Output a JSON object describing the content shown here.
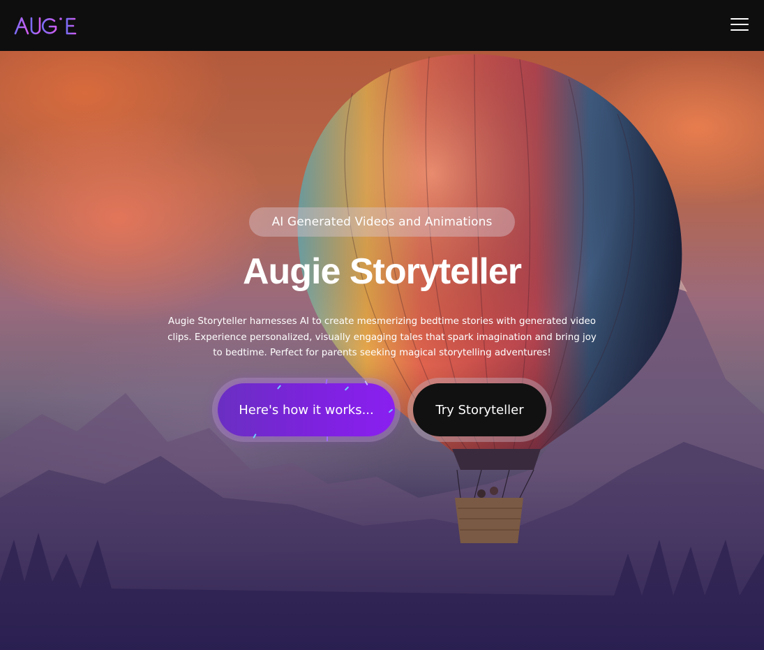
{
  "header": {
    "logo_text": "AUGiE",
    "menu_icon": "hamburger-menu-icon"
  },
  "hero": {
    "chip_label": "AI Generated Videos and Animations",
    "headline": "Augie Storyteller",
    "description": "Augie Storyteller harnesses AI to create mesmerizing bedtime stories with generated video clips. Experience personalized, visually engaging tales that spark imagination and bring joy to bedtime. Perfect for parents seeking magical storytelling adventures!",
    "primary_button": "Here's how it works...",
    "secondary_button": "Try Storyteller"
  },
  "colors": {
    "header_bg": "#0e0e0e",
    "logo_gradient_start": "#8b5cf6",
    "logo_gradient_end": "#d946ef",
    "primary_button": "#7d22de",
    "secondary_button": "#111111"
  }
}
